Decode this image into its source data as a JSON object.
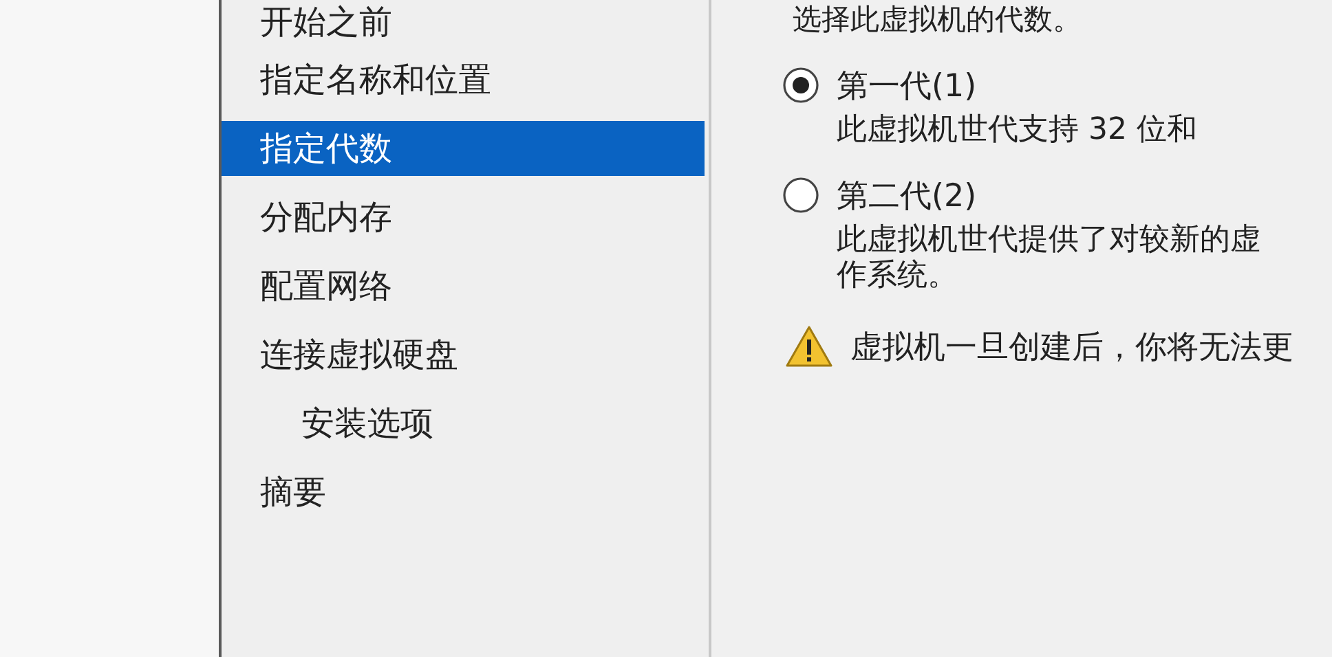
{
  "sidebar": {
    "items": [
      {
        "label": "开始之前",
        "selected": false
      },
      {
        "label": "指定名称和位置",
        "selected": false
      },
      {
        "label": "指定代数",
        "selected": true
      },
      {
        "label": "分配内存",
        "selected": false
      },
      {
        "label": "配置网络",
        "selected": false
      },
      {
        "label": "连接虚拟硬盘",
        "selected": false,
        "children": [
          {
            "label": "安装选项",
            "selected": false
          }
        ]
      },
      {
        "label": "摘要",
        "selected": false
      }
    ]
  },
  "content": {
    "intro": "选择此虚拟机的代数。",
    "options": [
      {
        "label": "第一代(1)",
        "selected": true,
        "description": [
          "此虚拟机世代支持 32 位和"
        ]
      },
      {
        "label": "第二代(2)",
        "selected": false,
        "description": [
          "此虚拟机世代提供了对较新的虚",
          "作系统。"
        ]
      }
    ],
    "warning": "虚拟机一旦创建后，你将无法更"
  }
}
